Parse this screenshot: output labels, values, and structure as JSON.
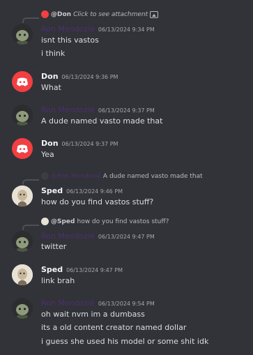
{
  "messages": [
    {
      "reply": {
        "author": "@Don",
        "text": "Click to see attachment"
      },
      "author": "Ron Mendoziè",
      "timestamp": "06/13/2024 9:34 PM",
      "lines": [
        "isnt this vastos",
        "i think"
      ]
    },
    {
      "author": "Don",
      "timestamp": "06/13/2024 9:36 PM",
      "lines": [
        "What"
      ]
    },
    {
      "author": "Ron Mendoziè",
      "timestamp": "06/13/2024 9:37 PM",
      "lines": [
        "A dude named vasto made that"
      ]
    },
    {
      "author": "Don",
      "timestamp": "06/13/2024 9:37 PM",
      "lines": [
        "Yea"
      ]
    },
    {
      "reply": {
        "author": "@Ron Mendoziè",
        "text": "A dude named vasto made that"
      },
      "author": "Sped",
      "timestamp": "06/13/2024 9:46 PM",
      "lines": [
        "how do you find vastos stuff?"
      ]
    },
    {
      "reply": {
        "author": "@Sped",
        "text": "how do you find vastos stuff?"
      },
      "author": "Ron Mendoziè",
      "timestamp": "06/13/2024 9:47 PM",
      "lines": [
        "twitter"
      ]
    },
    {
      "author": "Sped",
      "timestamp": "06/13/2024 9:47 PM",
      "lines": [
        "link brah"
      ]
    },
    {
      "author": "Ron Mendoziè",
      "timestamp": "06/13/2024 9:54 PM",
      "lines": [
        "oh wait nvm im a dumbass",
        "its a old content creator named dollar",
        "i guess she used his model or some shit idk"
      ]
    }
  ],
  "colors": {
    "background": "#313338",
    "discord_red": "#f23f42",
    "ron_name": "#4f2f6e",
    "text": "#dbdee1",
    "timestamp": "#a5a8ae"
  }
}
